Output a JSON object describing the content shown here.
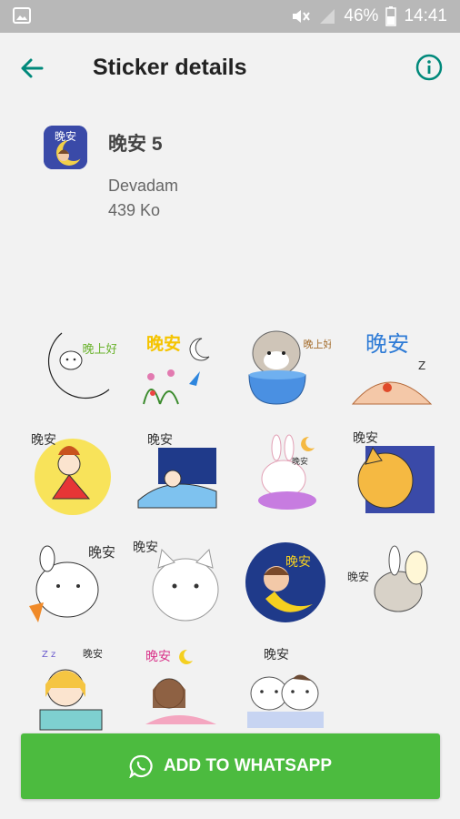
{
  "status_bar": {
    "battery": "46%",
    "time": "14:41"
  },
  "app_bar": {
    "title": "Sticker details"
  },
  "pack": {
    "name": "晚安 5",
    "author": "Devadam",
    "size": "439 Ko",
    "icon_text": "晚安"
  },
  "stickers": [
    {
      "id": "moon-bunny",
      "text": "晚上好"
    },
    {
      "id": "flowers-night",
      "text": "晚安"
    },
    {
      "id": "dog-cup",
      "text": "晚上好"
    },
    {
      "id": "sleeping-blob",
      "text": "晚安"
    },
    {
      "id": "little-my",
      "text": "晚安"
    },
    {
      "id": "sleeping-bed",
      "text": "晚安"
    },
    {
      "id": "bunny-pillow",
      "text": "晚安"
    },
    {
      "id": "moon-cat",
      "text": "晚安"
    },
    {
      "id": "bunny-carrot",
      "text": "晚安"
    },
    {
      "id": "white-cat",
      "text": "晚安"
    },
    {
      "id": "girl-moon",
      "text": "晚安"
    },
    {
      "id": "bunny-sleep",
      "text": "晚安"
    },
    {
      "id": "girl-blanket",
      "text": "晚安"
    },
    {
      "id": "girl-lying",
      "text": "晚安"
    },
    {
      "id": "two-cats",
      "text": "晚安"
    }
  ],
  "add_button": {
    "label": "ADD TO WHATSAPP",
    "icon": "whatsapp-icon"
  },
  "colors": {
    "accent": "#00897b",
    "button": "#4cbb3f",
    "statusbar": "#b8b8b8",
    "background": "#f2f2f2"
  }
}
